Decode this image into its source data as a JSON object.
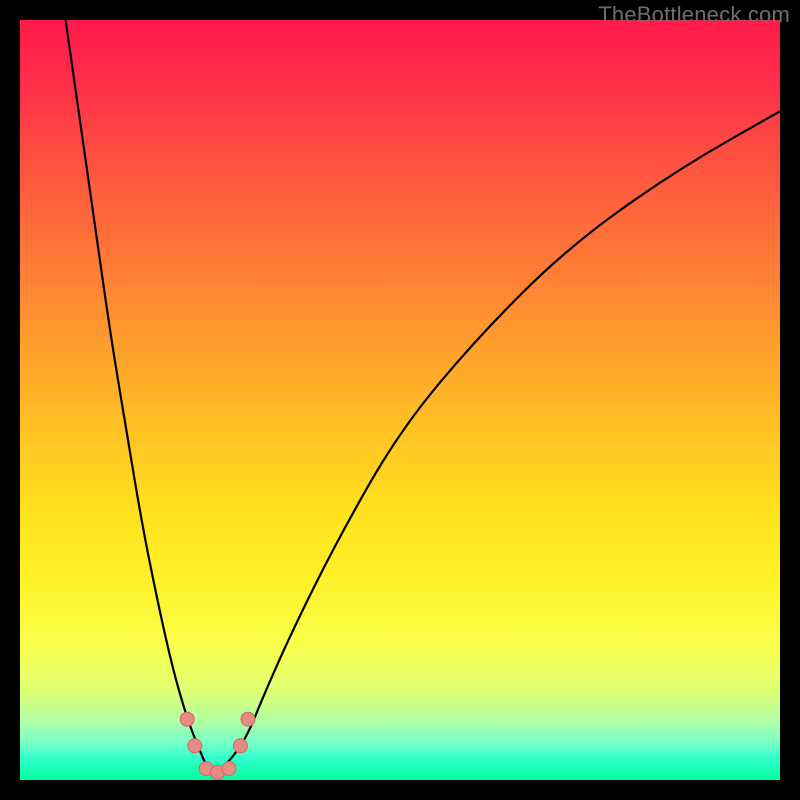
{
  "watermark": "TheBottleneck.com",
  "chart_data": {
    "type": "line",
    "title": "",
    "xlabel": "",
    "ylabel": "",
    "xlim": [
      0,
      100
    ],
    "ylim": [
      0,
      100
    ],
    "grid": false,
    "legend": false,
    "series": [
      {
        "name": "bottleneck-curve",
        "x": [
          6,
          8,
          10,
          12,
          14,
          16,
          18,
          20,
          22,
          24,
          25,
          26,
          28,
          30,
          32,
          36,
          42,
          50,
          60,
          72,
          86,
          100
        ],
        "y": [
          100,
          86,
          72,
          58,
          46,
          34,
          24,
          15,
          8,
          3,
          1,
          1,
          3,
          6,
          11,
          20,
          32,
          46,
          58,
          70,
          80,
          88
        ]
      }
    ],
    "markers": [
      {
        "name": "marker-left-upper",
        "x": 22.0,
        "y": 8.0
      },
      {
        "name": "marker-left-lower",
        "x": 23.0,
        "y": 4.5
      },
      {
        "name": "marker-bottom-1",
        "x": 24.5,
        "y": 1.5
      },
      {
        "name": "marker-bottom-2",
        "x": 26.0,
        "y": 1.0
      },
      {
        "name": "marker-bottom-3",
        "x": 27.5,
        "y": 1.5
      },
      {
        "name": "marker-right-lower",
        "x": 29.0,
        "y": 4.5
      },
      {
        "name": "marker-right-upper",
        "x": 30.0,
        "y": 8.0
      }
    ],
    "marker_style": {
      "fill": "#e88b84",
      "stroke": "#c96a63",
      "r": 7
    },
    "curve_style": {
      "stroke": "#000000",
      "width": 2.2
    }
  }
}
